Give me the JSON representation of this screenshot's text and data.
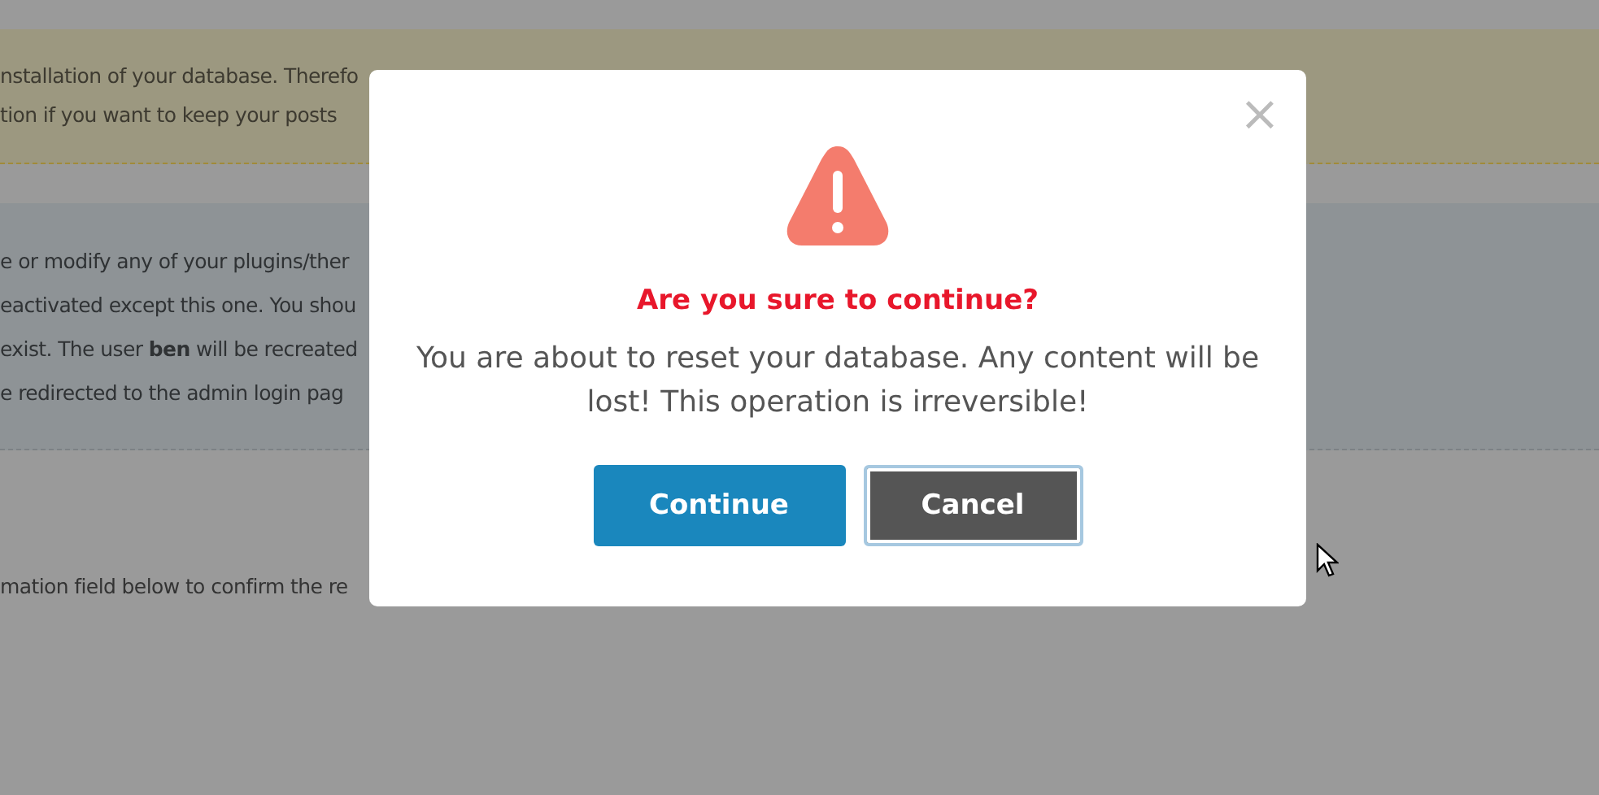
{
  "notice": {
    "lines": [
      "nstallation of your database. Therefo",
      "tion if you want to keep your posts"
    ]
  },
  "info": {
    "lines": [
      "e or modify any of your plugins/ther",
      "eactivated except this one. You shou",
      " exist. The user **ben** will be recreated",
      "e redirected to the admin login pag"
    ]
  },
  "confirm_hint": "mation field below to confirm the re",
  "dialog": {
    "title": "Are you sure to continue?",
    "message": "You are about to reset your database. Any content will be lost! This operation is irreversible!",
    "close": "×",
    "buttons": [
      {
        "label": "Continue",
        "kind": "primary",
        "focused": false
      },
      {
        "label": "Cancel",
        "kind": "secondary",
        "focused": true
      }
    ]
  }
}
